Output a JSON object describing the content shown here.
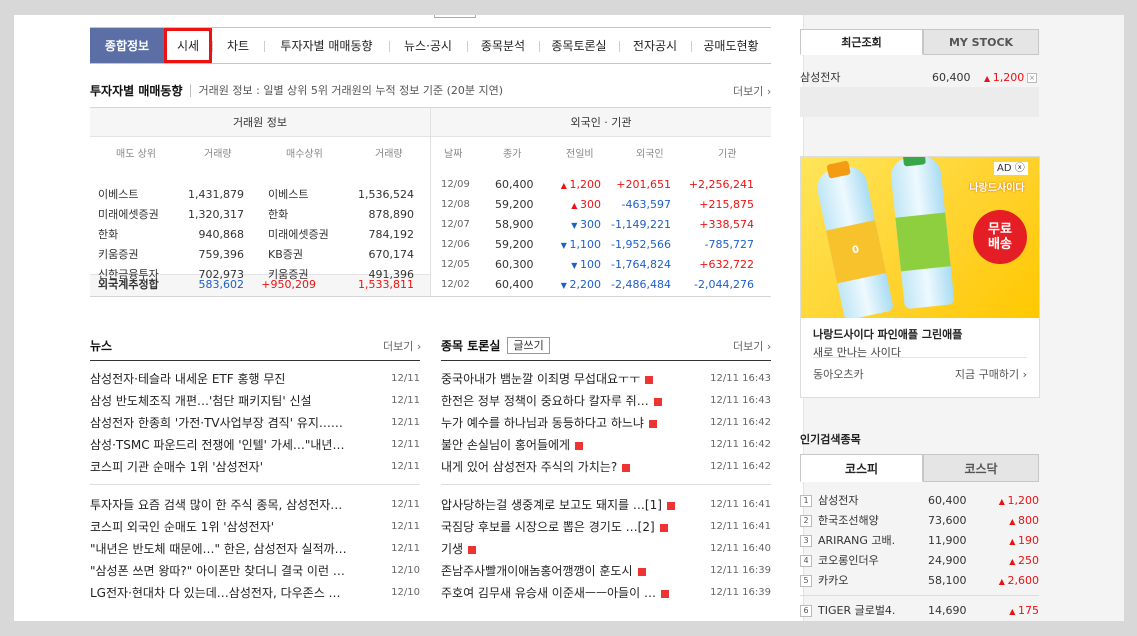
{
  "tabs": [
    "종합정보",
    "시세",
    "차트",
    "투자자별 매매동향",
    "뉴스·공시",
    "종목분석",
    "종목토론실",
    "전자공시",
    "공매도현황"
  ],
  "trade_section": {
    "title": "투자자별 매매동향",
    "subtitle": "거래원 정보 : 일별 상위 5위 거래원의 누적 정보 기준 (20분 지연)",
    "more": "더보기"
  },
  "trade_table": {
    "group_left": "거래원 정보",
    "group_right": "외국인 · 기관",
    "cols_left": [
      "매도 상위",
      "거래량",
      "매수상위",
      "거래량"
    ],
    "cols_right": [
      "날짜",
      "종가",
      "전일비",
      "외국인",
      "기관"
    ],
    "brokers": [
      [
        "이베스트",
        "1,431,879",
        "이베스트",
        "1,536,524"
      ],
      [
        "미래에셋증권",
        "1,320,317",
        "한화",
        "878,890"
      ],
      [
        "한화",
        "940,868",
        "미래에셋증권",
        "784,192"
      ],
      [
        "키움증권",
        "759,396",
        "KB증권",
        "670,174"
      ],
      [
        "신한금융투자",
        "702,973",
        "키움증권",
        "491,396"
      ]
    ],
    "summary": [
      "외국계추정합",
      "583,602",
      "+950,209",
      "1,533,811"
    ],
    "daily": [
      [
        "12/09",
        "60,400",
        "1,200",
        "up",
        "+201,651",
        "+2,256,241"
      ],
      [
        "12/08",
        "59,200",
        "300",
        "up",
        "-463,597",
        "+215,875"
      ],
      [
        "12/07",
        "58,900",
        "300",
        "down",
        "-1,149,221",
        "+338,574"
      ],
      [
        "12/06",
        "59,200",
        "1,100",
        "down",
        "-1,952,566",
        "-785,727"
      ],
      [
        "12/05",
        "60,300",
        "100",
        "down",
        "-1,764,824",
        "+632,722"
      ],
      [
        "12/02",
        "60,400",
        "2,200",
        "down",
        "-2,486,484",
        "-2,044,276"
      ]
    ]
  },
  "news": {
    "title": "뉴스",
    "more": "더보기",
    "items": [
      [
        "삼성전자·테슬라 내세운 ETF 홍행 무진",
        "12/11"
      ],
      [
        "삼성 반도체조직 개편…'첨단 패키지팀' 신설",
        "12/11"
      ],
      [
        "삼성전자 한종희 '가전·TV사업부장 겸직' 유지……",
        "12/11"
      ],
      [
        "삼성·TSMC 파운드리 전쟁에 '인텔' 가세…\"내년…",
        "12/11"
      ],
      [
        "코스피 기관 순매수 1위 '삼성전자'",
        "12/11"
      ],
      [
        "투자자들 요즘 검색 많이 한 주식 종목, 삼성전자…",
        "12/11"
      ],
      [
        "코스피 외국인 순매도 1위 '삼성전자'",
        "12/11"
      ],
      [
        "\"내년은 반도체 때문에…\" 한은, 삼성전자 실적까…",
        "12/11"
      ],
      [
        "\"삼성폰 쓰면 왕따?\" 아이폰만 찾더니 결국 이런 …",
        "12/10"
      ],
      [
        "LG전자·현대차 다 있는데…삼성전자, 다우존스 …",
        "12/10"
      ]
    ]
  },
  "board": {
    "title": "종목 토론실",
    "write": "글쓰기",
    "more": "더보기",
    "items": [
      [
        "중국아내가 뱀눈깔 이죄명 무섭대요ㅜㅜ",
        "12/11 16:43"
      ],
      [
        "한전은 정부 정책이 중요하다 칼자루 쥐…",
        "12/11 16:43"
      ],
      [
        "누가 예수를 하나님과 동등하다고 하느냐",
        "12/11 16:42"
      ],
      [
        "불안 손실님이 홍어들에게",
        "12/11 16:42"
      ],
      [
        "내게 있어 삼성전자 주식의 가치는?",
        "12/11 16:42"
      ],
      [
        "압사당하는걸 생중계로 보고도 돼지를 …[1]",
        "12/11 16:41"
      ],
      [
        "국짐당 후보를 시장으로 뽑은 경기도 …[2]",
        "12/11 16:41"
      ],
      [
        "기생",
        "12/11 16:40"
      ],
      [
        "존남주사빨개이애놈홍어깽깽이 훈도시",
        "12/11 16:39"
      ],
      [
        "주호여 김무새 유승새 이준새ㅡㅡ아들이 …",
        "12/11 16:39"
      ]
    ]
  },
  "recent": {
    "tab_on": "최근조회",
    "tab_off": "MY STOCK",
    "name": "삼성전자",
    "price": "60,400",
    "change": "1,200"
  },
  "ad": {
    "badge": "AD",
    "brand": "나랑드사이다",
    "title": "나랑드사이다 파인애플 그린애플",
    "desc": "새로 만나는 사이다",
    "advertiser": "동아오츠카",
    "cta": "지금 구매하기",
    "free_ship": "무료 배송"
  },
  "popular": {
    "title": "인기검색종목",
    "tab_on": "코스피",
    "tab_off": "코스닥",
    "items": [
      [
        "1",
        "삼성전자",
        "60,400",
        "1,200"
      ],
      [
        "2",
        "한국조선해양",
        "73,600",
        "800"
      ],
      [
        "3",
        "ARIRANG 고배.",
        "11,900",
        "190"
      ],
      [
        "4",
        "코오롱인더우",
        "24,900",
        "250"
      ],
      [
        "5",
        "카카오",
        "58,100",
        "2,600"
      ],
      [
        "6",
        "TIGER 글로벌4.",
        "14,690",
        "175"
      ]
    ]
  }
}
